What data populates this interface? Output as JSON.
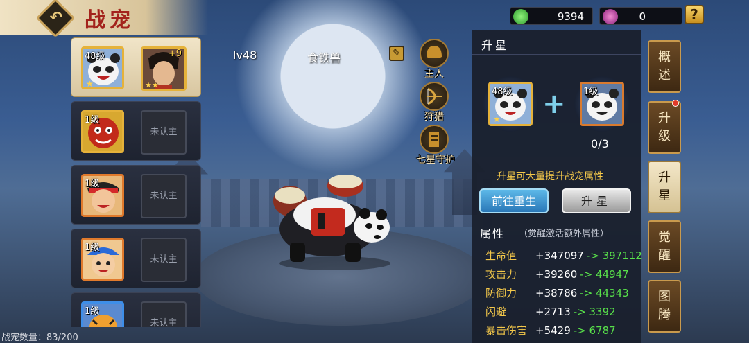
{
  "header": {
    "title": "战宠",
    "back_icon": "back-arrow-icon",
    "currency1": {
      "value": "9394",
      "color": "#3fbf4a",
      "icon": "jade-coin-icon"
    },
    "currency2": {
      "value": "0",
      "color": "#c83a9c",
      "icon": "purple-gem-icon"
    },
    "help": "?"
  },
  "pet_list": {
    "items": [
      {
        "level": "48级",
        "pet": "panda",
        "hero_plus": "+9",
        "hero": "warrior"
      },
      {
        "level": "1级",
        "pet": "red-lion",
        "slot": "未认主"
      },
      {
        "level": "1级",
        "pet": "boy-red-bandana",
        "slot": "未认主"
      },
      {
        "level": "1级",
        "pet": "boy-blue-hat",
        "slot": "未认主"
      },
      {
        "level": "1级",
        "pet": "tiger-cub",
        "slot": "未认主"
      }
    ],
    "count_label": "战宠数量：83/200"
  },
  "center": {
    "level": "lv48",
    "name": "食铁兽",
    "roles": [
      "主人",
      "狩猎",
      "七星守护"
    ]
  },
  "panel": {
    "title": "升星",
    "source_level": "48级",
    "material_level": "1级",
    "progress": "0/3",
    "hint": "升星可大量提升战宠属性",
    "btn_rebirth": "前往重生",
    "btn_star": "升星",
    "attr_title": "属性",
    "attr_sub": "（觉醒激活额外属性）",
    "attributes": [
      {
        "name": "生命值",
        "base": "+347097",
        "new": "-> 397112"
      },
      {
        "name": "攻击力",
        "base": "+39260",
        "new": "-> 44947"
      },
      {
        "name": "防御力",
        "base": "+38786",
        "new": "-> 44343"
      },
      {
        "name": "闪避",
        "base": "+2713",
        "new": "-> 3392"
      },
      {
        "name": "暴击伤害",
        "base": "+5429",
        "new": "-> 6787"
      }
    ]
  },
  "tabs": [
    "概述",
    "升级",
    "升星",
    "觉醒",
    "图腾"
  ]
}
